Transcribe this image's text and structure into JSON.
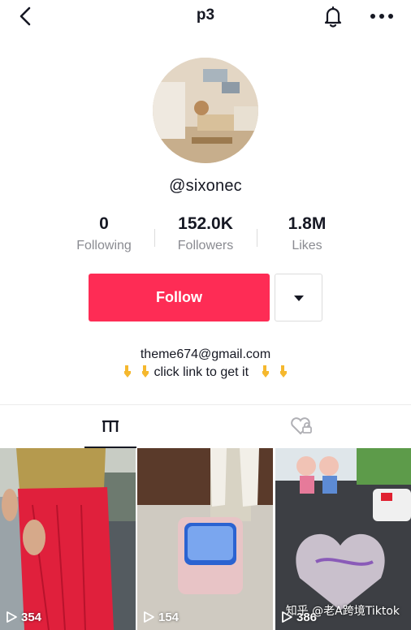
{
  "header": {
    "title": "p3",
    "back_icon": "chevron-left-icon",
    "notify_icon": "bell-icon",
    "more_icon": "ellipsis-icon"
  },
  "profile": {
    "username": "@sixonec",
    "avatar_icon": "profile-avatar"
  },
  "stats": [
    {
      "value": "0",
      "label": "Following"
    },
    {
      "value": "152.0K",
      "label": "Followers"
    },
    {
      "value": "1.8M",
      "label": "Likes"
    }
  ],
  "actions": {
    "follow_label": "Follow",
    "follow_color": "#fe2c55",
    "dropdown_icon": "triangle-down-icon"
  },
  "bio": {
    "line1": "theme674@gmail.com",
    "line2": "click link to get it",
    "emoji": "pointing-down-icon"
  },
  "tabs": [
    {
      "name": "videos",
      "icon": "grid-icon",
      "active": true
    },
    {
      "name": "liked",
      "icon": "heart-hidden-icon",
      "active": false
    }
  ],
  "videos": [
    {
      "views": "354",
      "icon": "play-icon"
    },
    {
      "views": "154",
      "icon": "play-icon"
    },
    {
      "views": "386",
      "icon": "play-icon"
    }
  ],
  "watermark": "知乎 @老A跨境Tiktok"
}
